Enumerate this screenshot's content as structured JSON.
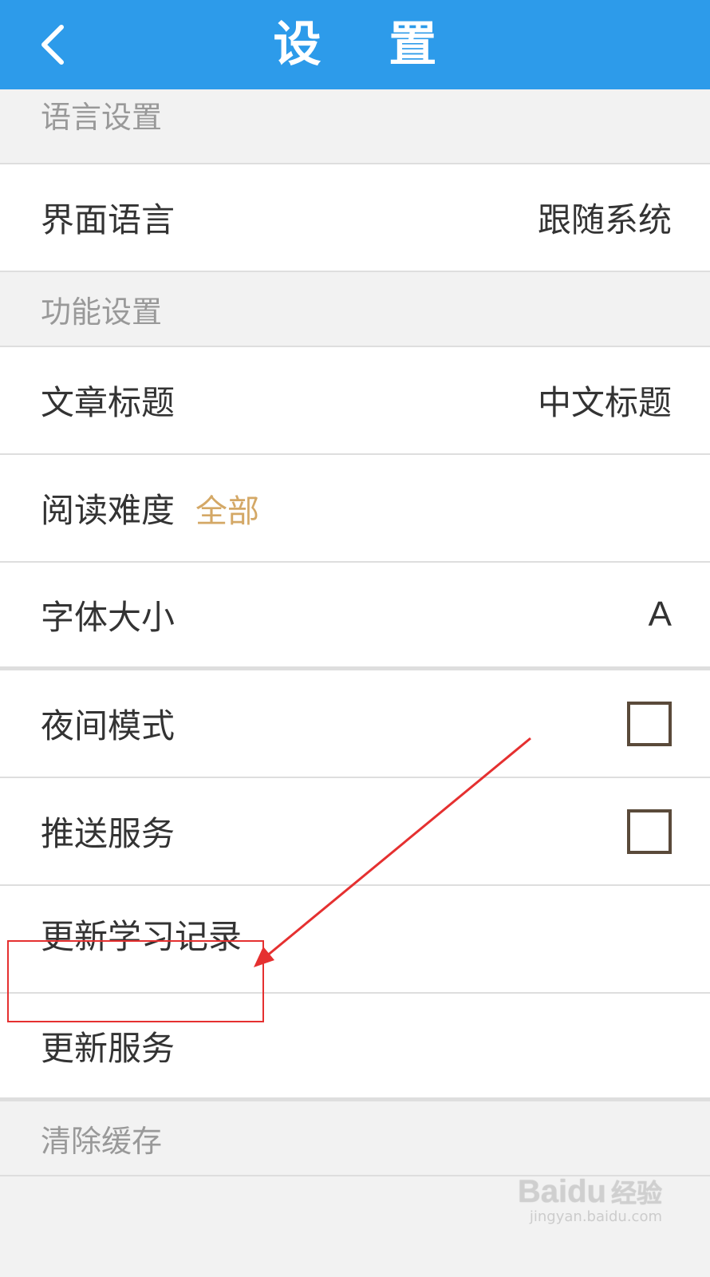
{
  "header": {
    "title": "设 置",
    "back_icon": "chevron-left-icon"
  },
  "sections": {
    "language": {
      "title": "语言设置"
    },
    "function": {
      "title": "功能设置"
    },
    "clear": {
      "title": "清除缓存"
    }
  },
  "rows": {
    "ui_language": {
      "label": "界面语言",
      "value": "跟随系统"
    },
    "article_title": {
      "label": "文章标题",
      "value": "中文标题"
    },
    "reading_difficulty": {
      "label": "阅读难度",
      "value": "全部"
    },
    "font_size": {
      "label": "字体大小",
      "value": "A"
    },
    "night_mode": {
      "label": "夜间模式",
      "checked": false
    },
    "push_service": {
      "label": "推送服务",
      "checked": false
    },
    "update_records": {
      "label": "更新学习记录"
    },
    "update_service": {
      "label": "更新服务"
    }
  },
  "colors": {
    "header": "#2d9bea",
    "accent_value": "#d4a866",
    "annotation": "#e53030"
  },
  "watermark": {
    "logo": "Baidu",
    "logo_cn": "经验",
    "url": "jingyan.baidu.com"
  }
}
